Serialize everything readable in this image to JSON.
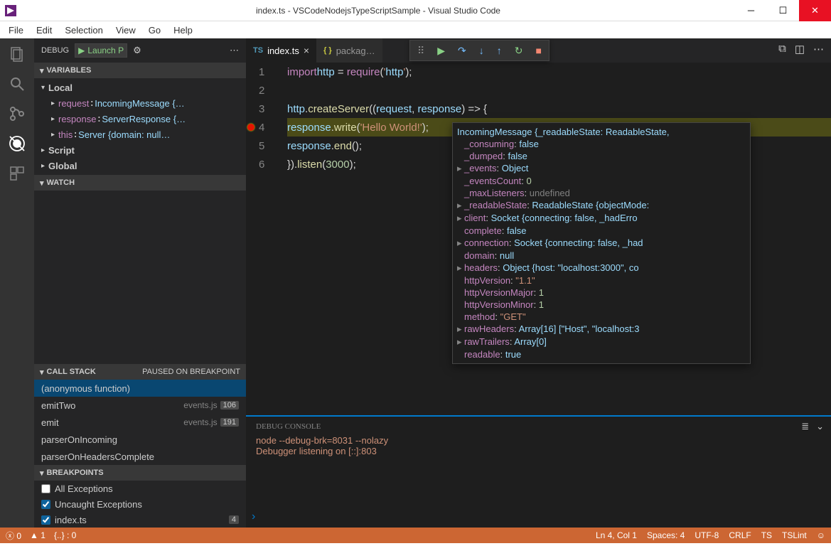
{
  "window": {
    "title": "index.ts - VSCodeNodejsTypeScriptSample - Visual Studio Code"
  },
  "menubar": [
    "File",
    "Edit",
    "Selection",
    "View",
    "Go",
    "Help"
  ],
  "debug_launch": {
    "label": "DEBUG",
    "config": "Launch P"
  },
  "variables": {
    "header": "VARIABLES",
    "scopes": [
      {
        "name": "Local",
        "expanded": true,
        "items": [
          {
            "k": "request",
            "v": "IncomingMessage {…"
          },
          {
            "k": "response",
            "v": "ServerResponse {…"
          },
          {
            "k": "this",
            "v": "Server {domain: null…"
          }
        ]
      },
      {
        "name": "Script",
        "expanded": false
      },
      {
        "name": "Global",
        "expanded": false
      }
    ]
  },
  "watch": {
    "header": "WATCH"
  },
  "callstack": {
    "header": "CALL STACK",
    "status": "PAUSED ON BREAKPOINT",
    "frames": [
      {
        "fn": "(anonymous function)",
        "src": "",
        "ln": "",
        "sel": true
      },
      {
        "fn": "emitTwo",
        "src": "events.js",
        "ln": "106"
      },
      {
        "fn": "emit",
        "src": "events.js",
        "ln": "191"
      },
      {
        "fn": "parserOnIncoming",
        "src": "",
        "ln": ""
      },
      {
        "fn": "parserOnHeadersComplete",
        "src": "",
        "ln": ""
      }
    ]
  },
  "breakpoints": {
    "header": "BREAKPOINTS",
    "items": [
      {
        "label": "All Exceptions",
        "checked": false
      },
      {
        "label": "Uncaught Exceptions",
        "checked": true
      },
      {
        "label": "index.ts",
        "checked": true,
        "ln": "4"
      }
    ]
  },
  "tabs": [
    {
      "icon": "TS",
      "label": "index.ts",
      "active": true
    },
    {
      "icon": "{ }",
      "label": "packag…",
      "active": false,
      "json": true
    }
  ],
  "code": {
    "lines": [
      "import http = require('http');",
      "",
      "http.createServer((request, response) => {",
      "    response.write('Hello World!');",
      "    response.end();",
      "}).listen(3000);"
    ],
    "breakpoint_line": 4,
    "highlight_line": 4
  },
  "hover": {
    "head": "IncomingMessage {_readableState: ReadableState,",
    "props": [
      {
        "k": "_consuming",
        "v": "false",
        "t": "bool"
      },
      {
        "k": "_dumped",
        "v": "false",
        "t": "bool"
      },
      {
        "k": "_events",
        "v": "Object",
        "t": "obj",
        "exp": true
      },
      {
        "k": "_eventsCount",
        "v": "0",
        "t": "num"
      },
      {
        "k": "_maxListeners",
        "v": "undefined",
        "t": "und"
      },
      {
        "k": "_readableState",
        "v": "ReadableState {objectMode:",
        "t": "obj",
        "exp": true
      },
      {
        "k": "client",
        "v": "Socket {connecting: false, _hadErro",
        "t": "obj",
        "exp": true
      },
      {
        "k": "complete",
        "v": "false",
        "t": "bool"
      },
      {
        "k": "connection",
        "v": "Socket {connecting: false, _had",
        "t": "obj",
        "exp": true
      },
      {
        "k": "domain",
        "v": "null",
        "t": "bool"
      },
      {
        "k": "headers",
        "v": "Object {host: \"localhost:3000\", co",
        "t": "obj",
        "exp": true
      },
      {
        "k": "httpVersion",
        "v": "\"1.1\"",
        "t": "str"
      },
      {
        "k": "httpVersionMajor",
        "v": "1",
        "t": "num"
      },
      {
        "k": "httpVersionMinor",
        "v": "1",
        "t": "num"
      },
      {
        "k": "method",
        "v": "\"GET\"",
        "t": "str"
      },
      {
        "k": "rawHeaders",
        "v": "Array[16] [\"Host\", \"localhost:3",
        "t": "obj",
        "exp": true
      },
      {
        "k": "rawTrailers",
        "v": "Array[0]",
        "t": "obj",
        "exp": true
      },
      {
        "k": "readable",
        "v": "true",
        "t": "bool"
      }
    ]
  },
  "console": {
    "title": "DEBUG CONSOLE",
    "lines": [
      "node --debug-brk=8031 --nolazy",
      "Debugger listening on [::]:803"
    ]
  },
  "status": {
    "errors": "0",
    "warnings": "1",
    "braces": "{..} : 0",
    "ln": "Ln 4, Col 1",
    "spaces": "Spaces: 4",
    "enc": "UTF-8",
    "eol": "CRLF",
    "lang": "TS",
    "lint": "TSLint"
  }
}
